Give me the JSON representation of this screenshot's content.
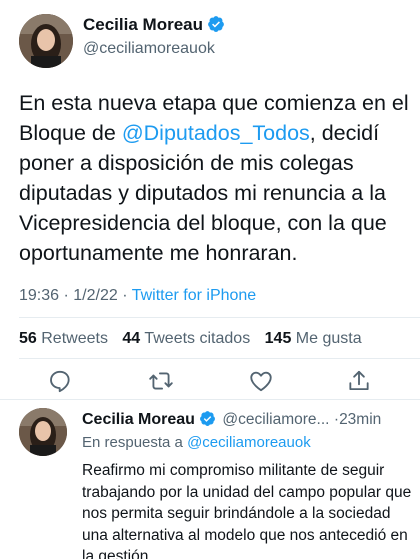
{
  "main_tweet": {
    "author": {
      "name": "Cecilia Moreau",
      "handle": "@ceciliamoreauok",
      "verified": true
    },
    "text_before": "En esta nueva etapa que comienza en el Bloque de ",
    "mention": "@Diputados_Todos",
    "text_after": ", decidí poner a disposición de mis colegas diputadas y diputados mi renuncia a la Vicepresidencia del bloque, con la que oportunamente me honraran.",
    "time": "19:36",
    "date": "1/2/22",
    "separator": "·",
    "source": "Twitter for iPhone",
    "stats": {
      "retweets_count": "56",
      "retweets_label": "Retweets",
      "quotes_count": "44",
      "quotes_label": "Tweets citados",
      "likes_count": "145",
      "likes_label": "Me gusta"
    },
    "actions": [
      "reply-icon",
      "retweet-icon",
      "like-icon",
      "share-icon"
    ]
  },
  "reply_tweet": {
    "author": {
      "name": "Cecilia Moreau",
      "handle": "@ceciliamore...",
      "verified": true
    },
    "separator": "·",
    "time_ago": "23min",
    "in_reply_to_label": "En respuesta a",
    "in_reply_to_handle": "@ceciliamoreauok",
    "text": "Reafirmo mi compromiso militante de seguir trabajando por la unidad del campo popular que nos permita seguir brindándole a la sociedad una alternativa al modelo que nos antecedió en la gestión."
  },
  "colors": {
    "accent": "#1d9bf0",
    "muted": "#536471",
    "text": "#0f1419",
    "divider": "#e6ecf0"
  }
}
